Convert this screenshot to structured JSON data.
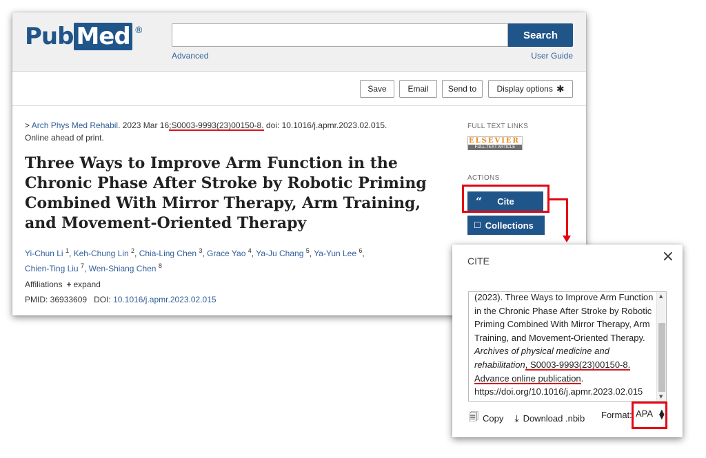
{
  "header": {
    "logo_left": "Pub",
    "logo_box": "Med",
    "logo_reg": "®",
    "search_placeholder": "",
    "search_button": "Search",
    "advanced_link": "Advanced",
    "user_guide_link": "User Guide"
  },
  "toolbar": {
    "save": "Save",
    "email": "Email",
    "send_to": "Send to",
    "display_options": "Display options"
  },
  "article": {
    "journal_prefix": "> ",
    "journal": "Arch Phys Med Rehabil",
    "date": ". 2023 Mar 16",
    "pii": ";S0003-9993(23)00150-8.",
    "doi_text": " doi: 10.1016/j.apmr.2023.02.015.",
    "status": "Online ahead of print.",
    "title": "Three Ways to Improve Arm Function in the Chronic Phase After Stroke by Robotic Priming Combined With Mirror Therapy, Arm Training, and Movement-Oriented Therapy",
    "authors": [
      {
        "name": "Yi-Chun Li",
        "aff": "1"
      },
      {
        "name": "Keh-Chung Lin",
        "aff": "2"
      },
      {
        "name": "Chia-Ling Chen",
        "aff": "3"
      },
      {
        "name": "Grace Yao",
        "aff": "4"
      },
      {
        "name": "Ya-Ju Chang",
        "aff": "5"
      },
      {
        "name": "Ya-Yun Lee",
        "aff": "6"
      },
      {
        "name": "Chien-Ting Liu",
        "aff": "7"
      },
      {
        "name": "Wen-Shiang Chen",
        "aff": "8"
      }
    ],
    "affiliations_label": "Affiliations",
    "expand_label": "expand",
    "pmid_label": "PMID: 36933609",
    "doi_label": "DOI: ",
    "doi_value": "10.1016/j.apmr.2023.02.015"
  },
  "sidebar": {
    "full_text_links": "FULL TEXT LINKS",
    "elsevier_top": "ELSEVIER",
    "elsevier_bottom": "FULL-TEXT ARTICLE",
    "actions": "ACTIONS",
    "cite_icon": "“",
    "cite": "Cite",
    "collections_icon": "☐",
    "collections": "Collections"
  },
  "cite_modal": {
    "title": "CITE",
    "close": "×",
    "lines": [
      "(2023). Three Ways to Improve Arm Function",
      "in the Chronic Phase After Stroke by Robotic",
      "Priming Combined With Mirror Therapy, Arm",
      "Training, and Movement-Oriented Therapy."
    ],
    "journal_italic_1": "Archives of physical medicine and",
    "journal_italic_2": "rehabilitation",
    "pii": ", S0003-9993(23)00150-8.",
    "advance": "Advance online publication",
    "advance_end": ".",
    "doi_url": "https://doi.org/10.1016/j.apmr.2023.02.015",
    "copy": "Copy",
    "download": "Download .nbib",
    "format_label": "Format:",
    "format_value": "APA"
  },
  "colors": {
    "pubmed_blue": "#20558a",
    "link_blue": "#325f9a",
    "highlight_red": "#e30613"
  },
  "icons": [
    "gear-icon",
    "quote-icon",
    "bookmark-icon",
    "close-icon",
    "copy-icon",
    "download-icon",
    "select-arrows-icon"
  ]
}
